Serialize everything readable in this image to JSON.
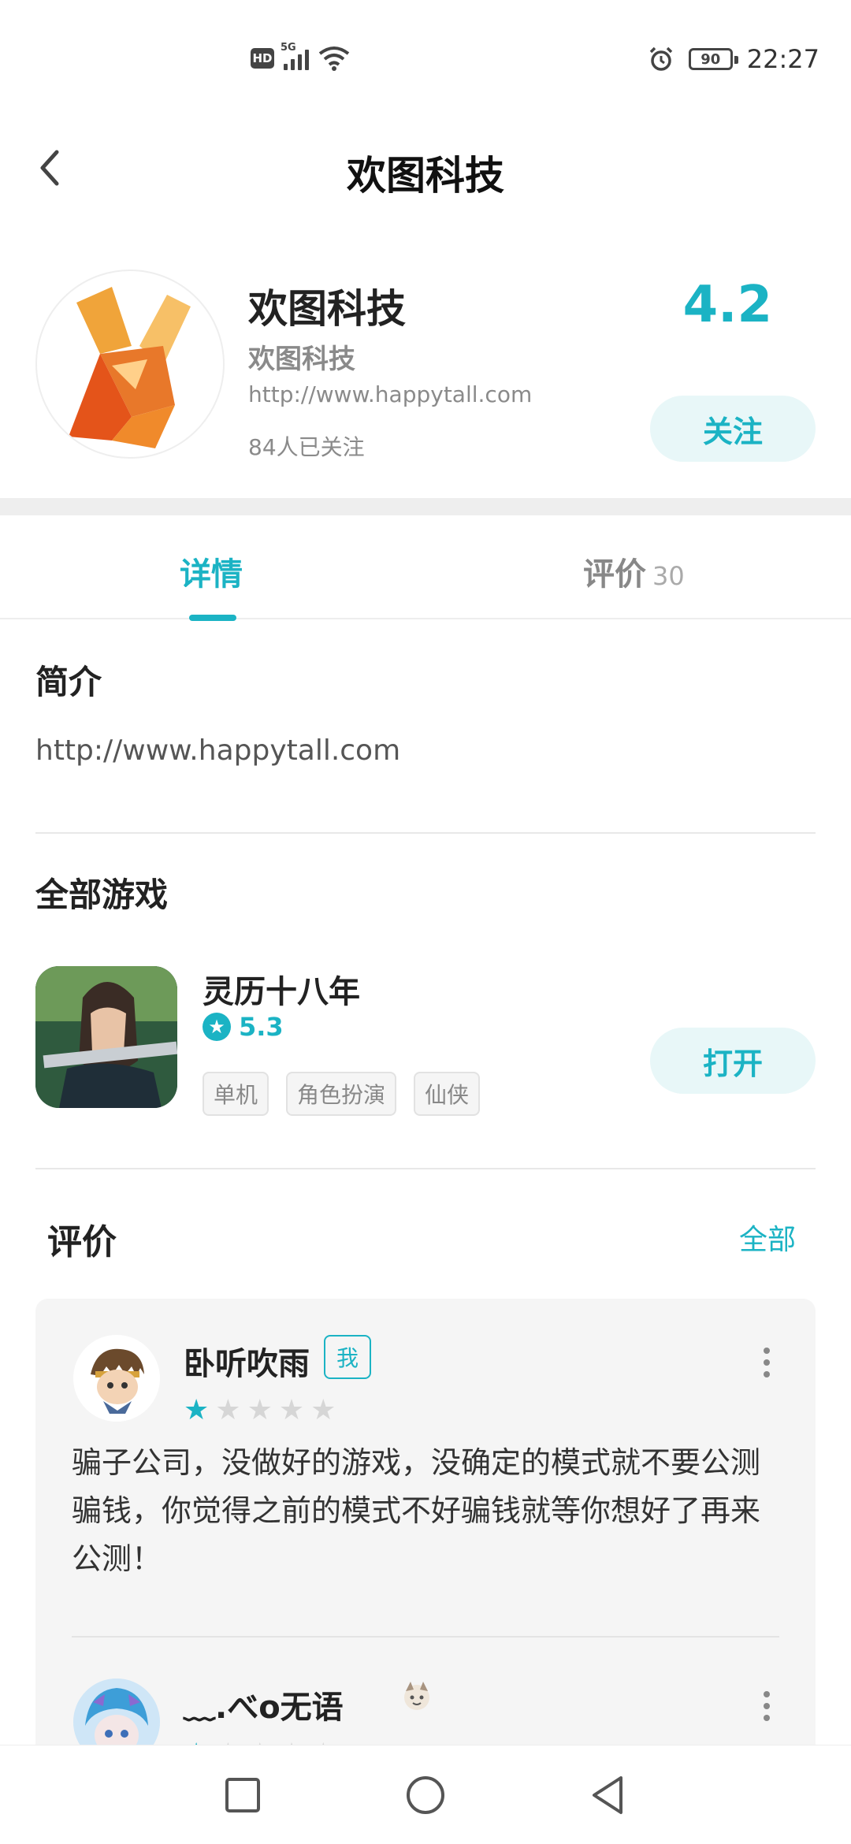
{
  "status_bar": {
    "hd": "HD",
    "network": "5G",
    "battery": "90",
    "time": "22:27"
  },
  "header": {
    "title": "欢图科技"
  },
  "publisher": {
    "name": "欢图科技",
    "subtitle": "欢图科技",
    "url": "http://www.happytall.com",
    "followers": "84人已关注",
    "rating": "4.2",
    "follow_label": "关注"
  },
  "tabs": [
    {
      "label": "详情"
    },
    {
      "label": "评价",
      "count": "30"
    }
  ],
  "intro": {
    "heading": "简介",
    "text": "http://www.happytall.com"
  },
  "games": {
    "heading": "全部游戏",
    "items": [
      {
        "name": "灵历十八年",
        "score": "5.3",
        "tags": [
          "单机",
          "角色扮演",
          "仙侠"
        ],
        "action": "打开"
      }
    ]
  },
  "reviews": {
    "heading": "评价",
    "all_label": "全部",
    "items": [
      {
        "user": "卧听吹雨",
        "badge": "我",
        "stars": 1,
        "text": "骗子公司，没做好的游戏，没确定的模式就不要公测骗钱，你觉得之前的模式不好骗钱就等你想好了再来公测！"
      },
      {
        "user": "﹏.べo无语",
        "stars": 1
      }
    ]
  },
  "colors": {
    "accent": "#1bb3c4",
    "accent_bg": "#e8f7f8"
  }
}
